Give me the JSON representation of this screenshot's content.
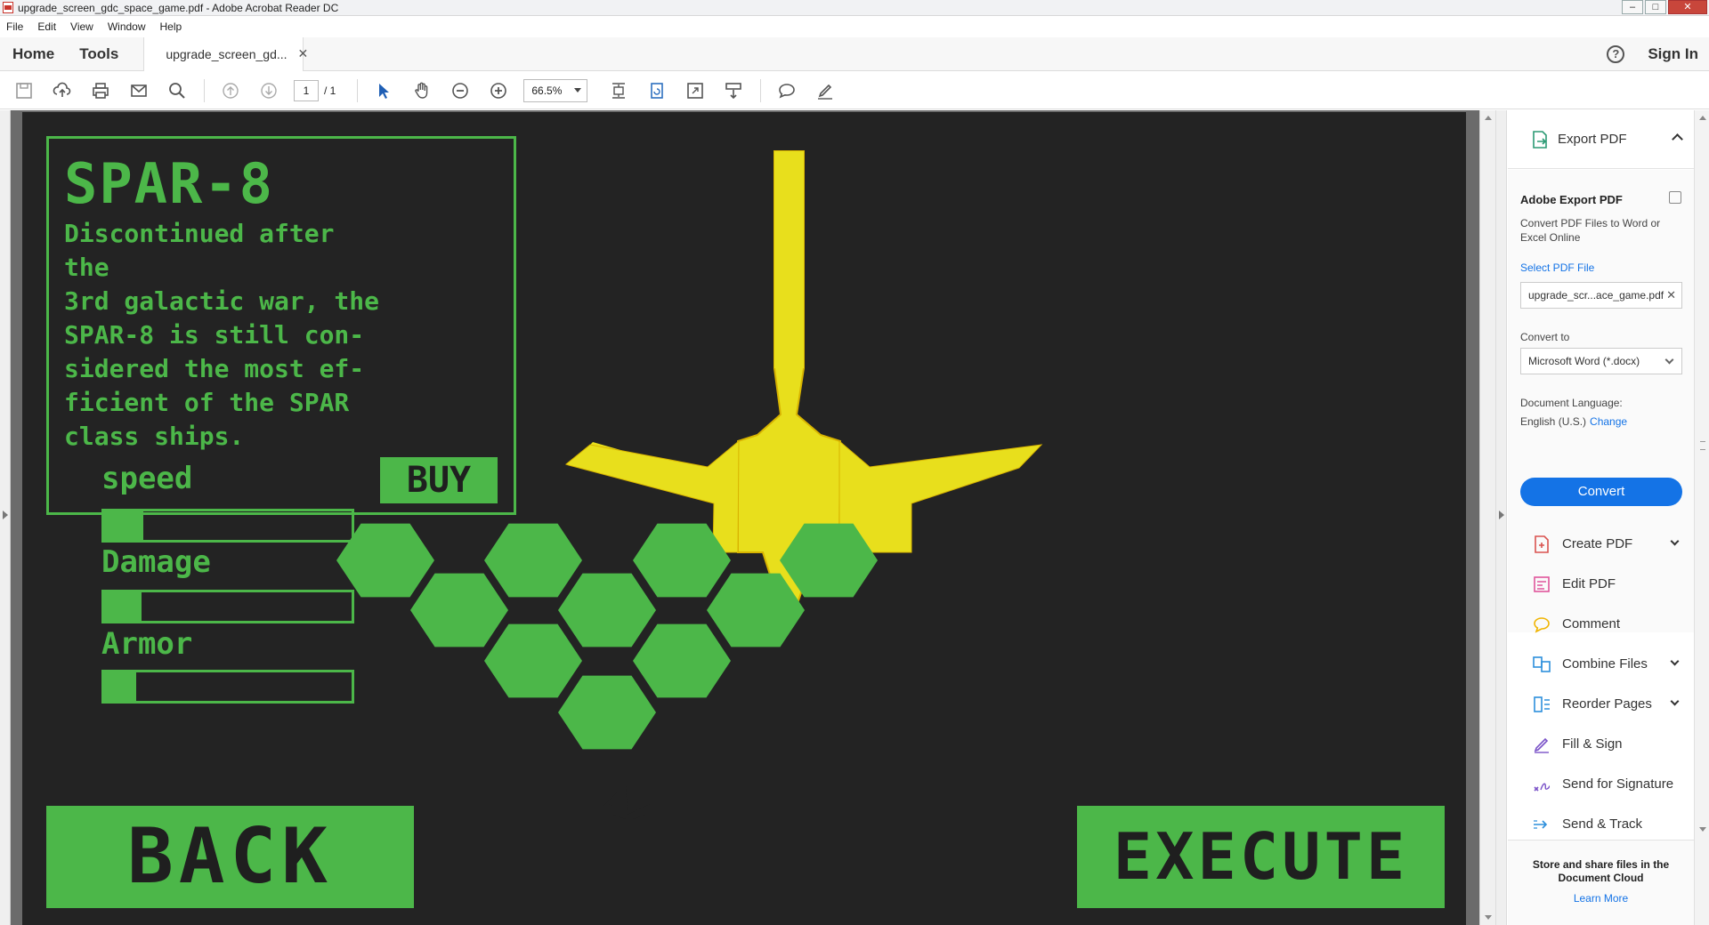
{
  "window": {
    "title": "upgrade_screen_gdc_space_game.pdf - Adobe Acrobat Reader DC"
  },
  "menu": [
    "File",
    "Edit",
    "View",
    "Window",
    "Help"
  ],
  "nav": {
    "home": "Home",
    "tools": "Tools",
    "doc_tab": "upgrade_screen_gd...",
    "sign_in": "Sign In"
  },
  "toolbar": {
    "page_current": "1",
    "page_total": "/ 1",
    "zoom": "66.5%"
  },
  "game": {
    "ship_name": "SPAR-8",
    "description": "Discontinued after the\n3rd galactic war, the\nSPAR-8 is still con-\nsidered the most ef-\nficient of the SPAR\nclass ships.",
    "buy_label": "BUY",
    "stats": [
      {
        "label": "speed",
        "level": 0.16
      },
      {
        "label": "Damage",
        "level": 0.15
      },
      {
        "label": "Armor",
        "level": 0.13
      }
    ],
    "back_label": "BACK",
    "execute_label": "EXECUTE",
    "colors": {
      "accent": "#4cb749",
      "background": "#232323",
      "ship": "#e8df1c",
      "ship_outline": "#d8b400"
    }
  },
  "tools_pane": {
    "export_header": "Export PDF",
    "export_title": "Adobe Export PDF",
    "export_sub": "Convert PDF Files to Word or Excel Online",
    "select_link": "Select PDF File",
    "file_value": "upgrade_scr...ace_game.pdf",
    "convert_to_label": "Convert to",
    "convert_to_value": "Microsoft Word (*.docx)",
    "lang_label": "Document Language:",
    "lang_value": "English (U.S.)",
    "lang_change": "Change",
    "convert_button": "Convert",
    "tools": [
      {
        "label": "Create PDF",
        "icon": "create-pdf-icon",
        "color": "#d9534f",
        "expand": true
      },
      {
        "label": "Edit PDF",
        "icon": "edit-pdf-icon",
        "color": "#e0559c",
        "expand": false
      },
      {
        "label": "Comment",
        "icon": "comment-icon",
        "color": "#f0b400",
        "expand": false
      },
      {
        "label": "Combine Files",
        "icon": "combine-files-icon",
        "color": "#2d8fdc",
        "expand": true
      },
      {
        "label": "Reorder Pages",
        "icon": "reorder-pages-icon",
        "color": "#2d8fdc",
        "expand": true
      },
      {
        "label": "Fill & Sign",
        "icon": "fill-sign-icon",
        "color": "#7a52c8",
        "expand": false
      },
      {
        "label": "Send for Signature",
        "icon": "send-signature-icon",
        "color": "#7a52c8",
        "expand": false
      },
      {
        "label": "Send & Track",
        "icon": "send-track-icon",
        "color": "#2d8fdc",
        "expand": false
      }
    ],
    "cloud_text": "Store and share files in the Document Cloud",
    "learn_more": "Learn More"
  }
}
